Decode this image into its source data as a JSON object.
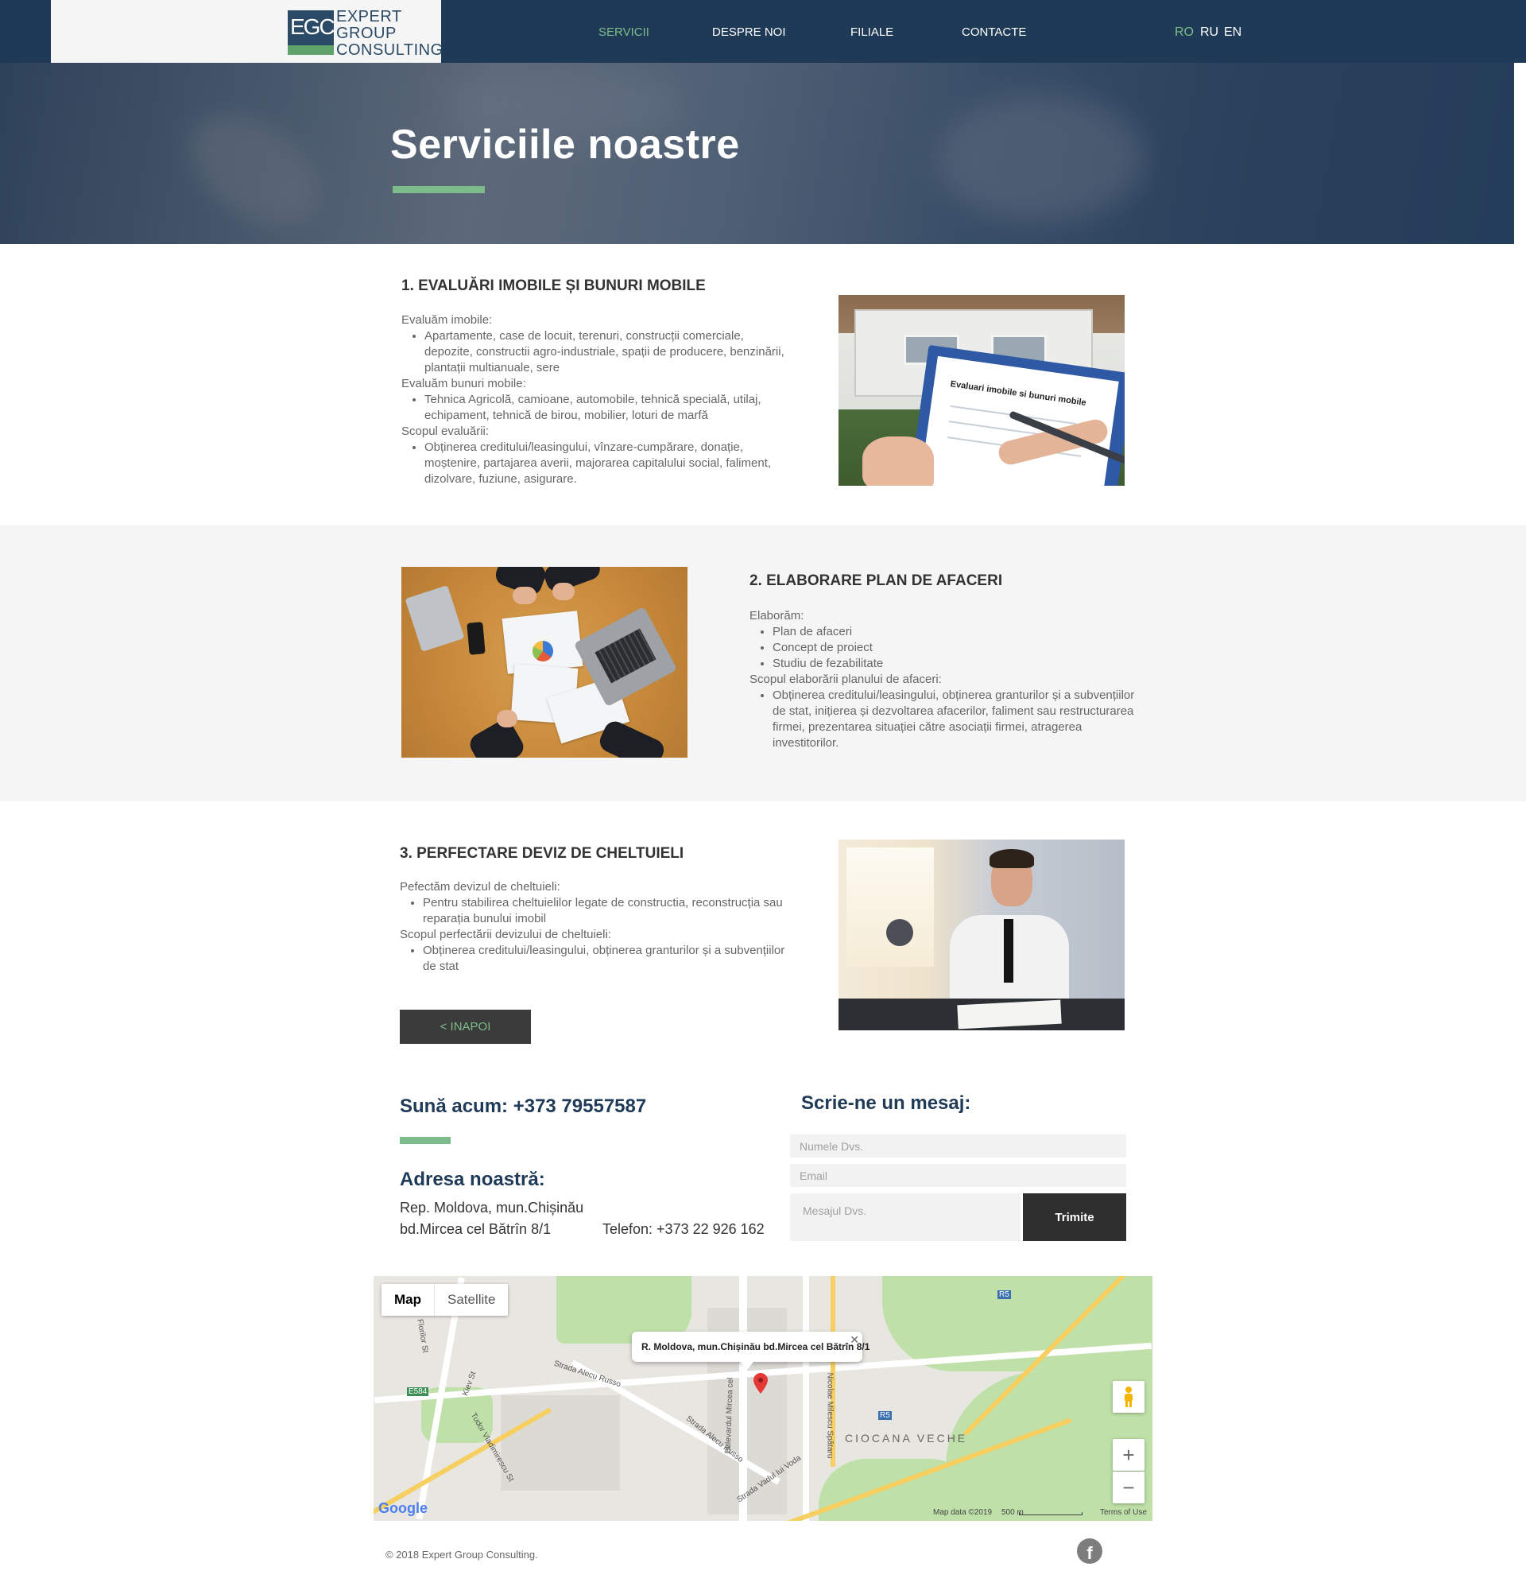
{
  "header": {
    "logo_letters": "EGC",
    "logo_text": [
      "EXPERT",
      "GROUP",
      "CONSULTING"
    ],
    "nav": [
      {
        "label": "SERVICII",
        "active": true
      },
      {
        "label": "DESPRE NOI",
        "active": false
      },
      {
        "label": "FILIALE",
        "active": false
      },
      {
        "label": "CONTACTE",
        "active": false
      }
    ],
    "languages": [
      {
        "label": "RO",
        "active": true
      },
      {
        "label": "RU",
        "active": false
      },
      {
        "label": "EN",
        "active": false
      }
    ]
  },
  "hero": {
    "title": "Serviciile noastre"
  },
  "services": [
    {
      "title": "1. EVALUĂRI IMOBILE ȘI BUNURI MOBILE",
      "intro_1": "Evaluăm imobile:",
      "items_1": [
        "Apartamente, case de locuit, terenuri, construcții comerciale, depozite, constructii agro-industriale, spații de producere, benzinării, plantații multianuale, sere"
      ],
      "intro_2": "Evaluăm bunuri mobile:",
      "items_2": [
        "Tehnica Agricolă, camioane, automobile, tehnică specială, utilaj, echipament, tehnică de birou, mobilier, loturi de marfă"
      ],
      "intro_3": "Scopul evaluării:",
      "items_3": [
        "Obținerea creditului/leasingului, vînzare-cumpărare, donație, moștenire, partajarea averii, majorarea capitalului social, faliment, dizolvare, fuziune, asigurare."
      ],
      "image_caption": "Evaluari imobile si bunuri mobile"
    },
    {
      "title": "2. ELABORARE PLAN DE AFACERI",
      "intro_1": "Elaborăm:",
      "items_1": [
        "Plan de afaceri",
        "Concept de proiect",
        "Studiu de fezabilitate"
      ],
      "intro_2": "Scopul elaborării planului de afaceri:",
      "items_2": [
        "Obținerea creditului/leasingului, obținerea granturilor și a subvențiilor de stat, inițierea și dezvoltarea afacerilor, faliment sau restructurarea firmei, prezentarea situației către asociații firmei, atragerea investitorilor."
      ]
    },
    {
      "title": "3. PERFECTARE DEVIZ DE CHELTUIELI",
      "intro_1": "Pefectăm devizul de cheltuieli:",
      "items_1": [
        "Pentru stabilirea cheltuielilor legate de constructia, reconstrucția sau reparația bunului imobil"
      ],
      "intro_2": "Scopul perfectării devizului de cheltuieli:",
      "items_2": [
        "Obținerea creditului/leasingului, obținerea granturilor și a subvențiilor de stat"
      ]
    }
  ],
  "back_button": "< INAPOI",
  "contact": {
    "call_now": "Sună acum: +373 79557587",
    "address_title": "Adresa noastră:",
    "address_line_1": "Rep. Moldova, mun.Chișinău",
    "address_line_2": "bd.Mircea cel Bătrîn 8/1",
    "phone": "Telefon: +373 22 926 162",
    "form_title": "Scrie-ne un mesaj:",
    "name_placeholder": "Numele Dvs.",
    "email_placeholder": "Email",
    "message_placeholder": "Mesajul Dvs.",
    "send_label": "Trimite"
  },
  "map": {
    "tabs": [
      {
        "label": "Map",
        "active": true
      },
      {
        "label": "Satellite",
        "active": false
      }
    ],
    "popup_text": "R. Moldova, mun.Chișinău bd.Mircea cel Bătrîn 8/1",
    "district": "CIOCANA VECHE",
    "labels": [
      "Strada Alecu Russo",
      "Strada Alecu Russo",
      "Bulevardul Mircea cel",
      "Nicolae Milescu Spătaru",
      "Strada Vadul lui Voda",
      "Florilor St",
      "Kiev St",
      "Tudor Vladimirescu St",
      "E584",
      "R5",
      "R5"
    ],
    "attribution": "Map data ©2019",
    "scale": "500 m",
    "terms": "Terms of Use",
    "google": "Google"
  },
  "footer": {
    "copyright": "© 2018 Expert Group Consulting.",
    "facebook_icon": "facebook-icon"
  },
  "colors": {
    "navy": "#1f3a57",
    "accent_green": "#7dbb8a",
    "dark_button": "#3b3b3b",
    "light_gray": "#f5f5f5"
  }
}
